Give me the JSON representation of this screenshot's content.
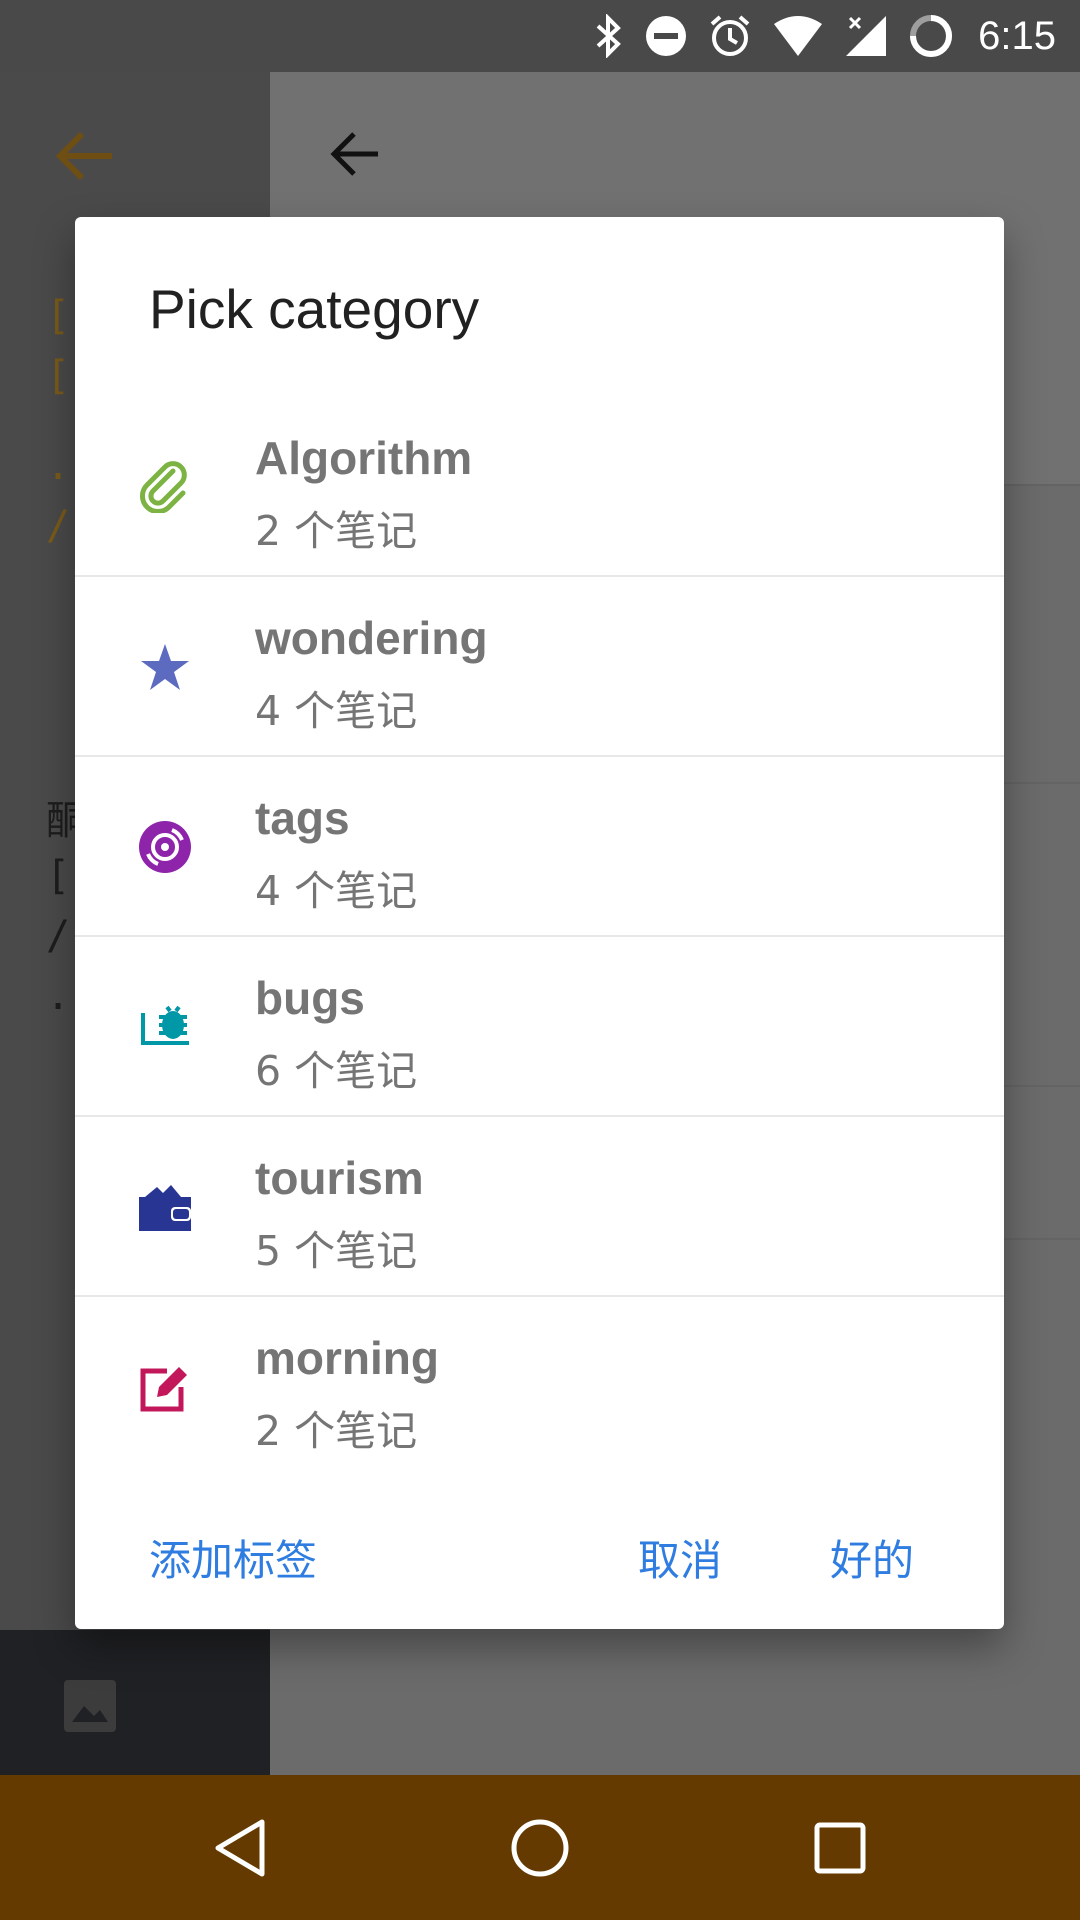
{
  "status_bar": {
    "time": "6:15"
  },
  "dialog": {
    "title": "Pick category",
    "categories": [
      {
        "name": "Algorithm",
        "count": "2 个笔记",
        "icon": "paperclip-icon",
        "color": "#7cb342"
      },
      {
        "name": "wondering",
        "count": "4 个笔记",
        "icon": "star-icon",
        "color": "#5c6bc0"
      },
      {
        "name": "tags",
        "count": "4 个笔记",
        "icon": "disc-icon",
        "color": "#8e24aa"
      },
      {
        "name": "bugs",
        "count": "6 个笔记",
        "icon": "bug-report-icon",
        "color": "#0097a7"
      },
      {
        "name": "tourism",
        "count": "5 个笔记",
        "icon": "wallet-icon",
        "color": "#283593"
      },
      {
        "name": "morning",
        "count": "2 个笔记",
        "icon": "edit-note-icon",
        "color": "#c2185b"
      }
    ],
    "actions": {
      "add_tag": "添加标签",
      "cancel": "取消",
      "ok": "好的"
    }
  },
  "colors": {
    "accent": "#2f7de1",
    "nav_bar": "#653a00"
  }
}
